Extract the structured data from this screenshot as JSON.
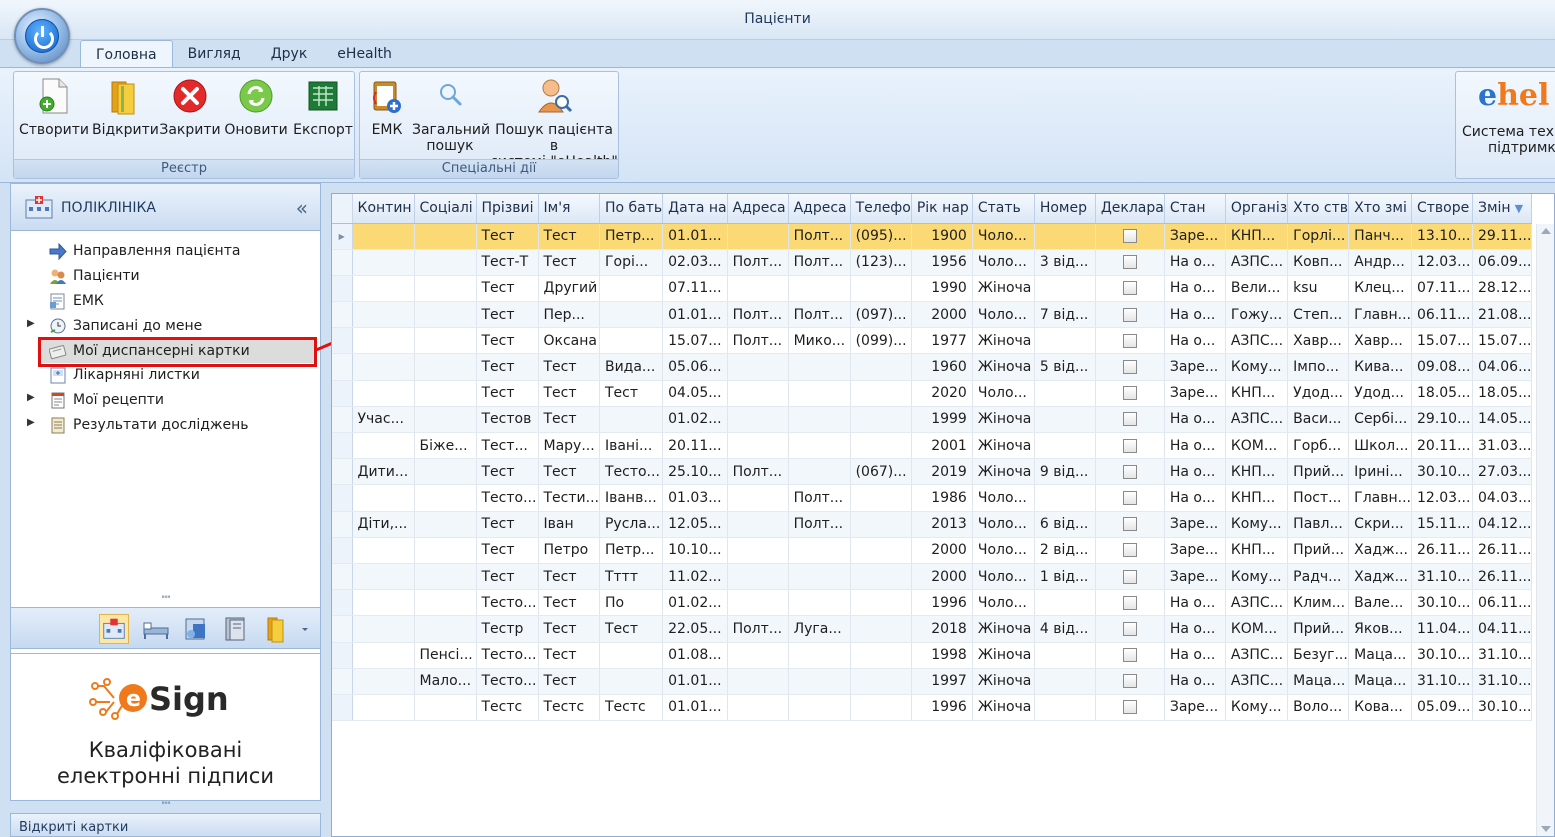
{
  "window": {
    "title": "Пацієнти"
  },
  "tabs": [
    {
      "label": "Головна",
      "active": true
    },
    {
      "label": "Вигляд"
    },
    {
      "label": "Друк"
    },
    {
      "label": "eHealth"
    }
  ],
  "ribbon": {
    "registry": {
      "label": "Реєстр",
      "buttons": [
        {
          "label": "Створити",
          "icon": "new-document-icon"
        },
        {
          "label": "Відкрити",
          "icon": "open-folder-icon"
        },
        {
          "label": "Закрити",
          "icon": "close-circle-icon"
        },
        {
          "label": "Оновити",
          "icon": "refresh-icon"
        },
        {
          "label": "Експорт",
          "icon": "excel-export-icon"
        }
      ]
    },
    "special": {
      "label": "Спеціальні дії",
      "buttons": [
        {
          "label": "ЕМК",
          "icon": "medical-card-icon"
        },
        {
          "label_line1": "Загальний",
          "label_line2": "пошук",
          "icon": "magnifier-icon"
        },
        {
          "label_line1": "Пошук пацієнта в",
          "label_line2": "системі \"eHealth\"",
          "icon": "user-search-icon"
        }
      ]
    },
    "support": {
      "logo_a": "e",
      "logo_b": "hel",
      "label_line1": "Система техні",
      "label_line2": "підтримки"
    }
  },
  "left_panel": {
    "title": "ПОЛІКЛІНІКА",
    "collapse": "«",
    "tree": [
      {
        "label": "Направлення пацієнта",
        "icon": "arrow-right-icon"
      },
      {
        "label": "Пацієнти",
        "icon": "patients-icon"
      },
      {
        "label": "ЕМК",
        "icon": "emk-icon"
      },
      {
        "label": "Записані до мене",
        "icon": "schedule-icon",
        "expandable": true
      },
      {
        "label": "Мої диспансерні картки",
        "icon": "card-icon",
        "selected": true
      },
      {
        "label": "Лікарняні листки",
        "icon": "sick-leave-icon"
      },
      {
        "label": "Мої рецепти",
        "icon": "prescription-icon",
        "expandable": true
      },
      {
        "label": "Результати досліджень",
        "icon": "results-icon",
        "expandable": true
      }
    ],
    "splitter": "''''''",
    "ad": {
      "brand_e": "e",
      "brand_rest": "Sign",
      "line1": "Кваліфіковані",
      "line2": "електронні підписи"
    },
    "opened_cards": "Відкриті картки"
  },
  "grid": {
    "columns": [
      "Контин",
      "Соціалі",
      "Прізвиі",
      "Ім'я",
      "По бать",
      "Дата на",
      "Адреса",
      "Адреса",
      "Телефо",
      "Рік нар",
      "Стать",
      "Номер",
      "Деклара",
      "Стан",
      "Організ",
      "Хто ств",
      "Хто змі",
      "Створе",
      "Змін"
    ],
    "sort_indicator": "▼",
    "selected_marker": "▶",
    "rows": [
      [
        "",
        "",
        "Тест",
        "Тест",
        "Петр...",
        "01.01...",
        "",
        "Полт...",
        "(095)...",
        "1900",
        "Чоло...",
        "",
        false,
        "Заре...",
        "КНП...",
        "Горлі...",
        "Панч...",
        "13.10...",
        "29.11..."
      ],
      [
        "",
        "",
        "Тест-Т",
        "Тест",
        "Горі...",
        "02.03...",
        "Полт...",
        "Полт...",
        "(123)...",
        "1956",
        "Чоло...",
        "3 від...",
        false,
        "На о...",
        "АЗПС...",
        "Ковп...",
        "Андр...",
        "12.03...",
        "06.09..."
      ],
      [
        "",
        "",
        "Тест",
        "Другий",
        "",
        "07.11...",
        "",
        "",
        "",
        "1990",
        "Жіноча",
        "",
        false,
        "На о...",
        "Вели...",
        "ksu",
        "Клец...",
        "07.11...",
        "28.12..."
      ],
      [
        "",
        "",
        "Тест",
        "Пер...",
        "",
        "01.01...",
        "Полт...",
        "Полт...",
        "(097)...",
        "2000",
        "Чоло...",
        "7 від...",
        false,
        "На о...",
        "Гожу...",
        "Степ...",
        "Главн...",
        "06.11...",
        "21.08..."
      ],
      [
        "",
        "",
        "Тест",
        "Оксана",
        "",
        "15.07...",
        "Полт...",
        "Мико...",
        "(099)...",
        "1977",
        "Жіноча",
        "",
        false,
        "На о...",
        "АЗПС...",
        "Хавр...",
        "Хавр...",
        "15.07...",
        "15.07..."
      ],
      [
        "",
        "",
        "Тест",
        "Тест",
        "Вида...",
        "05.06...",
        "",
        "",
        "",
        "1960",
        "Жіноча",
        "5 від...",
        false,
        "Заре...",
        "Кому...",
        "Імпо...",
        "Кива...",
        "09.08...",
        "04.06..."
      ],
      [
        "",
        "",
        "Тест",
        "Тест",
        "Тест",
        "04.05...",
        "",
        "",
        "",
        "2020",
        "Чоло...",
        "",
        false,
        "Заре...",
        "КНП...",
        "Удод...",
        "Удод...",
        "18.05...",
        "18.05..."
      ],
      [
        "Учас...",
        "",
        "Тестов",
        "Тест",
        "",
        "01.02...",
        "",
        "",
        "",
        "1999",
        "Жіноча",
        "",
        false,
        "На о...",
        "АЗПС...",
        "Васи...",
        "Сербі...",
        "29.10...",
        "14.05..."
      ],
      [
        "",
        "Біже...",
        "Тест...",
        "Мару...",
        "Івані...",
        "20.11...",
        "",
        "",
        "",
        "2001",
        "Жіноча",
        "",
        false,
        "На о...",
        "КОМ...",
        "Горб...",
        "Школ...",
        "20.11...",
        "31.03..."
      ],
      [
        "Дити...",
        "",
        "Тест",
        "Тест",
        "Тесто...",
        "25.10...",
        "Полт...",
        "",
        "(067)...",
        "2019",
        "Жіноча",
        "9 від...",
        false,
        "На о...",
        "КНП...",
        "Прий...",
        "Ірині...",
        "30.10...",
        "27.03..."
      ],
      [
        "",
        "",
        "Тесто...",
        "Тести...",
        "Іванв...",
        "01.03...",
        "",
        "Полт...",
        "",
        "1986",
        "Чоло...",
        "",
        false,
        "На о...",
        "КНП...",
        "Пост...",
        "Главн...",
        "12.03...",
        "04.03..."
      ],
      [
        "Діти,...",
        "",
        "Тест",
        "Іван",
        "Русла...",
        "12.05...",
        "",
        "Полт...",
        "",
        "2013",
        "Чоло...",
        "6 від...",
        false,
        "Заре...",
        "Кому...",
        "Павл...",
        "Скри...",
        "15.11...",
        "04.12..."
      ],
      [
        "",
        "",
        "Тест",
        "Петро",
        "Петр...",
        "10.10...",
        "",
        "",
        "",
        "2000",
        "Чоло...",
        "2 від...",
        false,
        "Заре...",
        "КНП...",
        "Прий...",
        "Хадж...",
        "26.11...",
        "26.11..."
      ],
      [
        "",
        "",
        "Тест",
        "Тест",
        "Тттт",
        "11.02...",
        "",
        "",
        "",
        "2000",
        "Чоло...",
        "1 від...",
        false,
        "Заре...",
        "Кому...",
        "Радч...",
        "Хадж...",
        "31.10...",
        "26.11..."
      ],
      [
        "",
        "",
        "Тесто...",
        "Тест",
        "По",
        "01.02...",
        "",
        "",
        "",
        "1996",
        "Чоло...",
        "",
        false,
        "На о...",
        "АЗПС...",
        "Клим...",
        "Вале...",
        "30.10...",
        "06.11..."
      ],
      [
        "",
        "",
        "Тестр",
        "Тест",
        "Тест",
        "22.05...",
        "Полт...",
        "Луга...",
        "",
        "2018",
        "Жіноча",
        "4 від...",
        false,
        "На о...",
        "КОМ...",
        "Прий...",
        "Яков...",
        "11.04...",
        "04.11..."
      ],
      [
        "",
        "Пенсі...",
        "Тесто...",
        "Тест",
        "",
        "01.08...",
        "",
        "",
        "",
        "1998",
        "Жіноча",
        "",
        false,
        "На о...",
        "АЗПС...",
        "Безуг...",
        "Маца...",
        "30.10...",
        "31.10..."
      ],
      [
        "",
        "Мало...",
        "Тесто...",
        "Тест",
        "",
        "01.01...",
        "",
        "",
        "",
        "1997",
        "Жіноча",
        "",
        false,
        "На о...",
        "АЗПС...",
        "Маца...",
        "Маца...",
        "31.10...",
        "31.10..."
      ],
      [
        "",
        "",
        "Тестс",
        "Тестс",
        "Тестс",
        "01.01...",
        "",
        "",
        "",
        "1996",
        "Жіноча",
        "",
        false,
        "Заре...",
        "Кому...",
        "Воло...",
        "Кова...",
        "05.09...",
        "30.10..."
      ]
    ]
  }
}
